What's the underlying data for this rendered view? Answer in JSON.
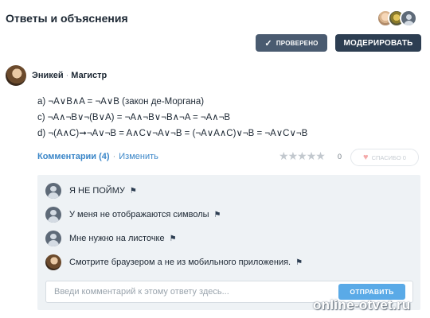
{
  "header": {
    "title": "Ответы и объяснения"
  },
  "actions": {
    "checked_label": "ПРОВЕРЕНО",
    "moderate_label": "МОДЕРИРОВАТЬ"
  },
  "answer": {
    "author_name": "Эникей",
    "author_rank": "Магистр",
    "lines": [
      "a) ¬A∨B∧A = ¬A∨B (закон де-Моргана)",
      "c) ¬A∧¬B∨¬(B∨A) = ¬A∧¬B∨¬B∧¬A = ¬A∧¬B",
      "d) ¬(A∧C)➞¬A∨¬B = A∧C∨¬A∨¬B = (¬A∨A∧C)∨¬B = ¬A∨C∨¬B"
    ],
    "comments_link": "Комментарии (4)",
    "edit_link": "Изменить",
    "rating_count": "0",
    "thanks_label": "СПАСИБО 0"
  },
  "comments": [
    {
      "text": "Я НЕ ПОЙМУ"
    },
    {
      "text": "У меня не отображаются символы"
    },
    {
      "text": "Мне нужно на листочке"
    },
    {
      "text": "Смотрите браузером а не из мобильного приложения."
    }
  ],
  "comment_form": {
    "placeholder": "Введи комментарий к этому ответу здесь...",
    "submit_label": "ОТПРАВИТЬ"
  },
  "watermark": "online-otvet.ru",
  "colors": {
    "link": "#3a86c8",
    "primary_button": "#2d3e52",
    "submit_button": "#5aaae7",
    "comments_bg": "#eef2f5"
  },
  "icons": {
    "checked": "check-icon",
    "flag": "flag-icon",
    "heart": "heart-icon",
    "star": "star-icon"
  }
}
